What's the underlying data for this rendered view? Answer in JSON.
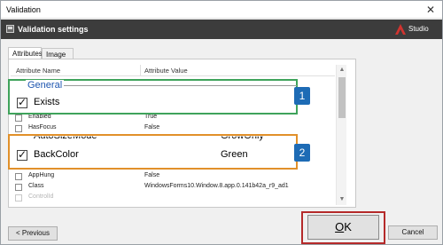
{
  "window": {
    "title": "Validation",
    "close_glyph": "✕"
  },
  "header": {
    "title": "Validation settings",
    "icon": "window-icon",
    "logo_text": "Studio",
    "logo_icon": "uipath-robot-icon"
  },
  "tabs": [
    {
      "label": "Attributes",
      "active": true
    },
    {
      "label": "Image",
      "active": false
    }
  ],
  "grid": {
    "columns": [
      "Attribute Name",
      "Attribute Value"
    ],
    "rows": [
      {
        "name": "Enabled",
        "value": "True",
        "checked": false
      },
      {
        "name": "HasFocus",
        "value": "False",
        "checked": false
      },
      {
        "name": "AppHung",
        "value": "False",
        "checked": false
      },
      {
        "name": "Class",
        "value": "WindowsForms10.Window.8.app.0.141b42a_r9_ad1",
        "checked": false
      },
      {
        "name": "ControlId",
        "value": "",
        "checked": false
      }
    ]
  },
  "zoom_general": {
    "group_label": "General",
    "item_label": "Exists",
    "checked": true,
    "badge": "1"
  },
  "zoom_backcolor": {
    "above_name": "AutoSizeMode",
    "above_value": "GrowOnly",
    "item_label": "BackColor",
    "item_value": "Green",
    "checked": true,
    "badge": "2"
  },
  "scrollbar": {
    "up_glyph": "▲",
    "down_glyph": "▼"
  },
  "buttons": {
    "previous": "< Previous",
    "ok_underlined": "O",
    "ok_rest": "K",
    "cancel": "Cancel"
  },
  "colors": {
    "green_highlight": "#3fa35b",
    "orange_highlight": "#e1902a",
    "ok_highlight": "#b52a2a",
    "badge_blue": "#1d6bb5",
    "header_dark": "#3c3c3c",
    "logo_red": "#d1332f"
  }
}
